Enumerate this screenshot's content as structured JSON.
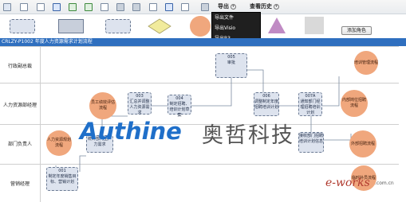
{
  "menu": {
    "export_label": "导出",
    "history_label": "查看历史"
  },
  "export_menu": {
    "items": [
      "导出文件",
      "导出Visio",
      "导出B3"
    ]
  },
  "palette": {
    "add_role_label": "添加角色"
  },
  "process": {
    "title": "CRLZY-P1002  年度人力资源需求计划流程"
  },
  "lanes": [
    "行政副总裁",
    "人力资源部经理",
    "部门负责人",
    "营销经理"
  ],
  "nodes": {
    "n005": {
      "id": "005",
      "label": "审批"
    },
    "n003": {
      "id": "003",
      "label": "汇总并调整人力资源需求"
    },
    "n004": {
      "id": "004",
      "label": "制定招聘、培训计划草案"
    },
    "n006": {
      "id": "006",
      "label": "调整制定年度招聘培训计划"
    },
    "n007": {
      "id": "007",
      "label": "通知部门经理招聘培训计划"
    },
    "n007a": {
      "id": "007A",
      "label": "通知部门经理招聘培训计划"
    },
    "n002": {
      "id": "002",
      "label": "统计部门生产力需求"
    },
    "n008": {
      "id": "008",
      "label": "接收部门招聘培训计划信息"
    },
    "n001": {
      "id": "001",
      "label": "制定年度销售目标、营销计划"
    },
    "c_staff": {
      "label": "员工绩效评估流程"
    },
    "c_plan": {
      "label": "人力资源规划流程"
    },
    "c_recruit_mgmt": {
      "label": "培训管理流程"
    },
    "c_internal": {
      "label": "内部岗位招聘流程"
    },
    "c_external": {
      "label": "外部招聘流程"
    },
    "c_temp": {
      "label": "临时补员流程"
    }
  },
  "watermark": {
    "brand": "Authine",
    "brand_cn": "奥哲科技",
    "site": "e-works",
    "site_sub": ".com.cn"
  },
  "colors": {
    "title_bar": "#2f6fbf",
    "task_box": "#dde3ee",
    "subprocess": "#f0a77d",
    "accent": "#1f6fc9"
  }
}
